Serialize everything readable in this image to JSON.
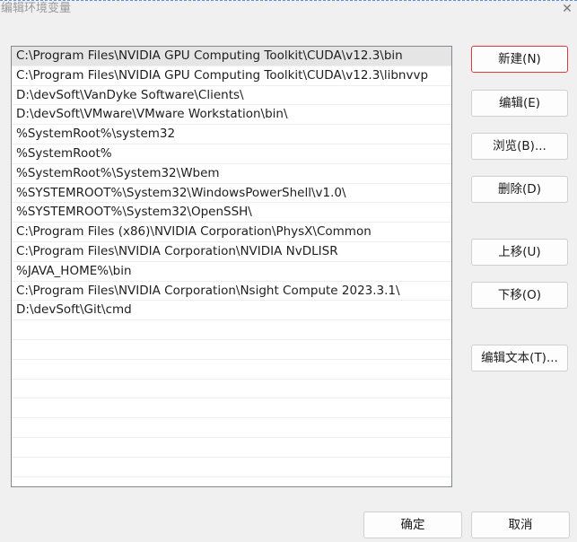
{
  "window": {
    "title": "编辑环境变量",
    "close_glyph": "✕"
  },
  "list": {
    "items": [
      "C:\\Program Files\\NVIDIA GPU Computing Toolkit\\CUDA\\v12.3\\bin",
      "C:\\Program Files\\NVIDIA GPU Computing Toolkit\\CUDA\\v12.3\\libnvvp",
      "D:\\devSoft\\VanDyke Software\\Clients\\",
      "D:\\devSoft\\VMware\\VMware Workstation\\bin\\",
      "%SystemRoot%\\system32",
      "%SystemRoot%",
      "%SystemRoot%\\System32\\Wbem",
      "%SYSTEMROOT%\\System32\\WindowsPowerShell\\v1.0\\",
      "%SYSTEMROOT%\\System32\\OpenSSH\\",
      "C:\\Program Files (x86)\\NVIDIA Corporation\\PhysX\\Common",
      "C:\\Program Files\\NVIDIA Corporation\\NVIDIA NvDLISR",
      "%JAVA_HOME%\\bin",
      "C:\\Program Files\\NVIDIA Corporation\\Nsight Compute 2023.3.1\\",
      "D:\\devSoft\\Git\\cmd"
    ]
  },
  "buttons": {
    "new": "新建(N)",
    "edit": "编辑(E)",
    "browse": "浏览(B)...",
    "delete": "删除(D)",
    "move_up": "上移(U)",
    "move_down": "下移(O)",
    "edit_text": "编辑文本(T)...",
    "ok": "确定",
    "cancel": "取消"
  },
  "colors": {
    "selected_row": "#e5e5e5",
    "default_button_border": "#e23a3a",
    "title_border": "#5b8fd6"
  }
}
